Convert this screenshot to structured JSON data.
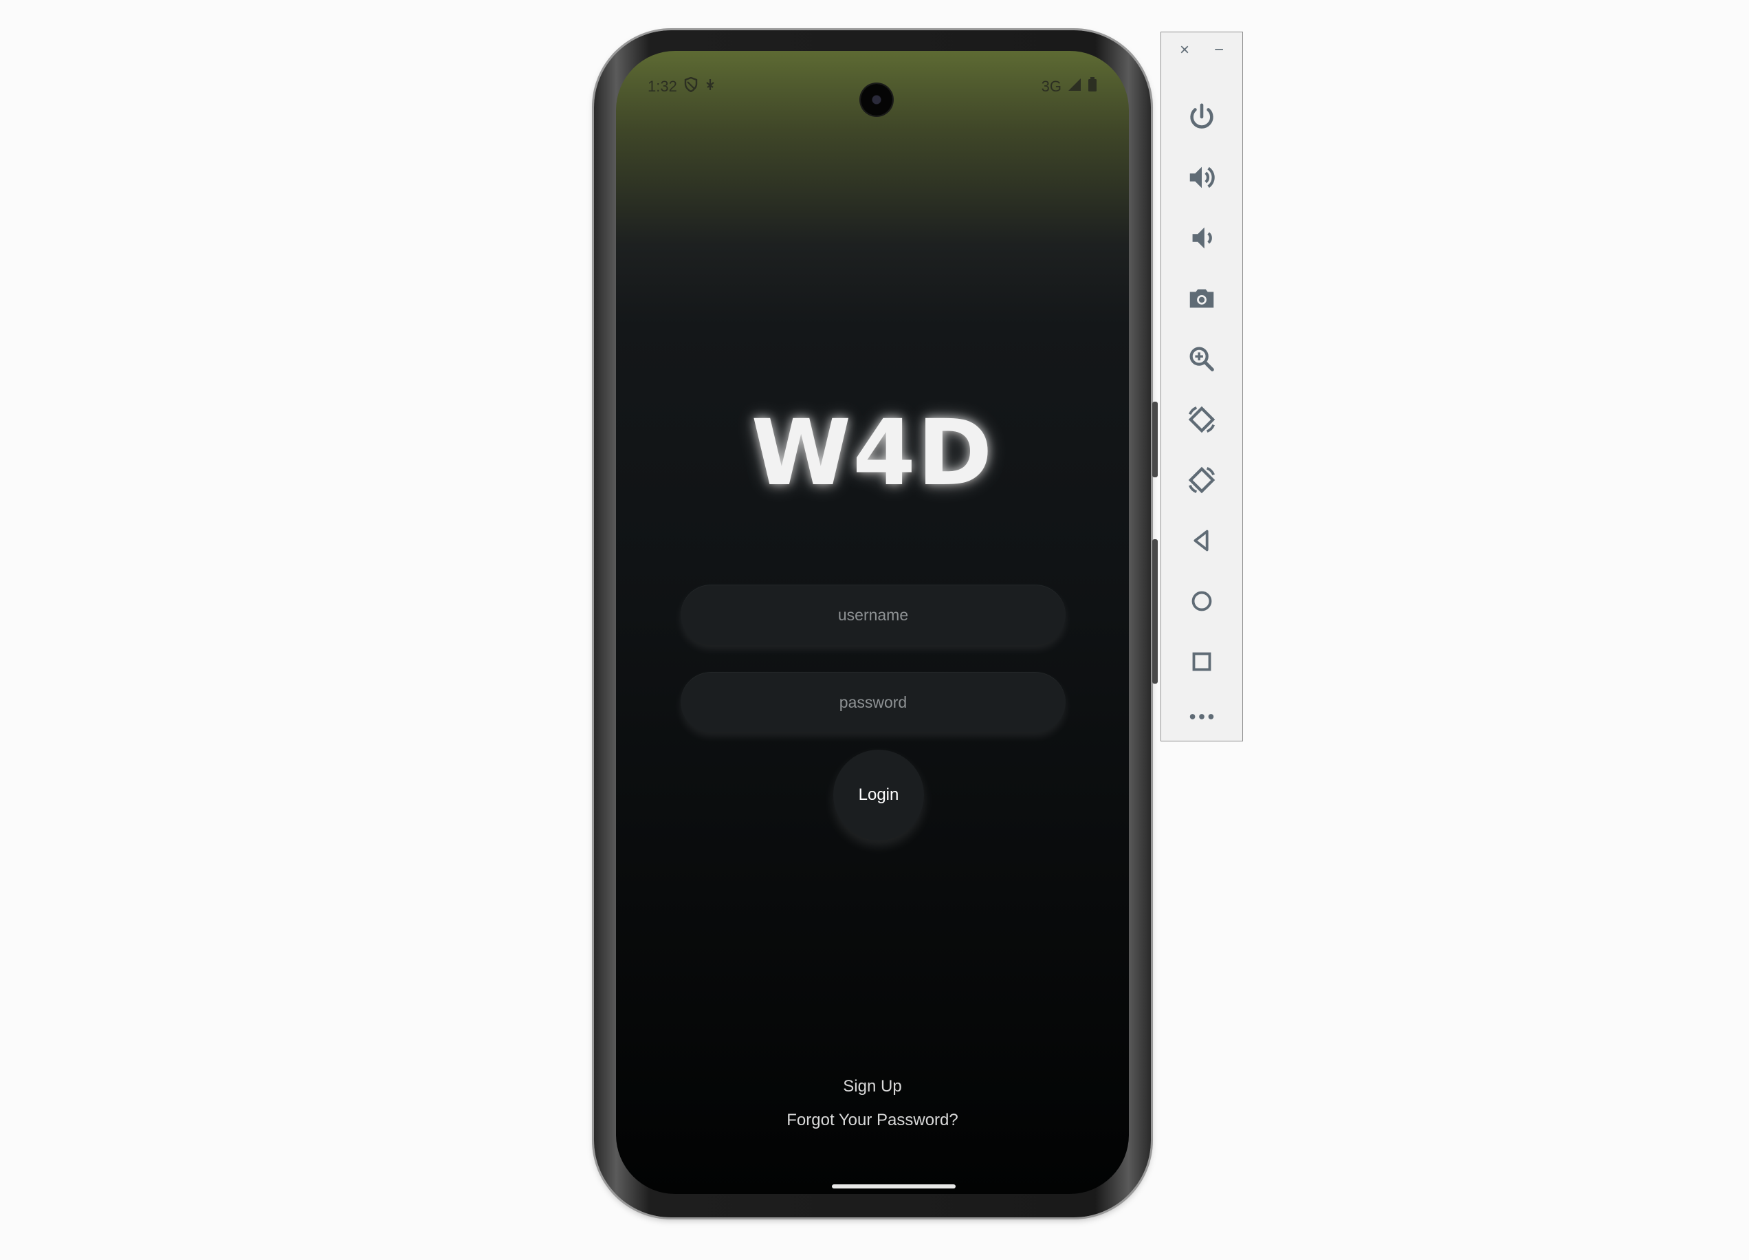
{
  "status_bar": {
    "time": "1:32",
    "network": "3G"
  },
  "app": {
    "logo": "W4D",
    "username_placeholder": "username",
    "password_placeholder": "password",
    "login_label": "Login",
    "signup_label": "Sign Up",
    "forgot_label": "Forgot Your Password?"
  },
  "colors": {
    "accent_top": "#5d6a33",
    "background_dark": "#101315",
    "field_bg": "#1b1e20",
    "toolbar_icon": "#5f6b75"
  },
  "emulator_toolbar": {
    "close_icon": "×",
    "minimize_icon": "−",
    "buttons": [
      {
        "icon": "power-icon"
      },
      {
        "icon": "volume-up-icon"
      },
      {
        "icon": "volume-down-icon"
      },
      {
        "icon": "camera-icon"
      },
      {
        "icon": "zoom-in-icon"
      },
      {
        "icon": "rotate-left-icon"
      },
      {
        "icon": "rotate-right-icon"
      },
      {
        "icon": "back-icon"
      },
      {
        "icon": "home-icon"
      },
      {
        "icon": "overview-icon"
      },
      {
        "icon": "more-icon"
      }
    ]
  }
}
